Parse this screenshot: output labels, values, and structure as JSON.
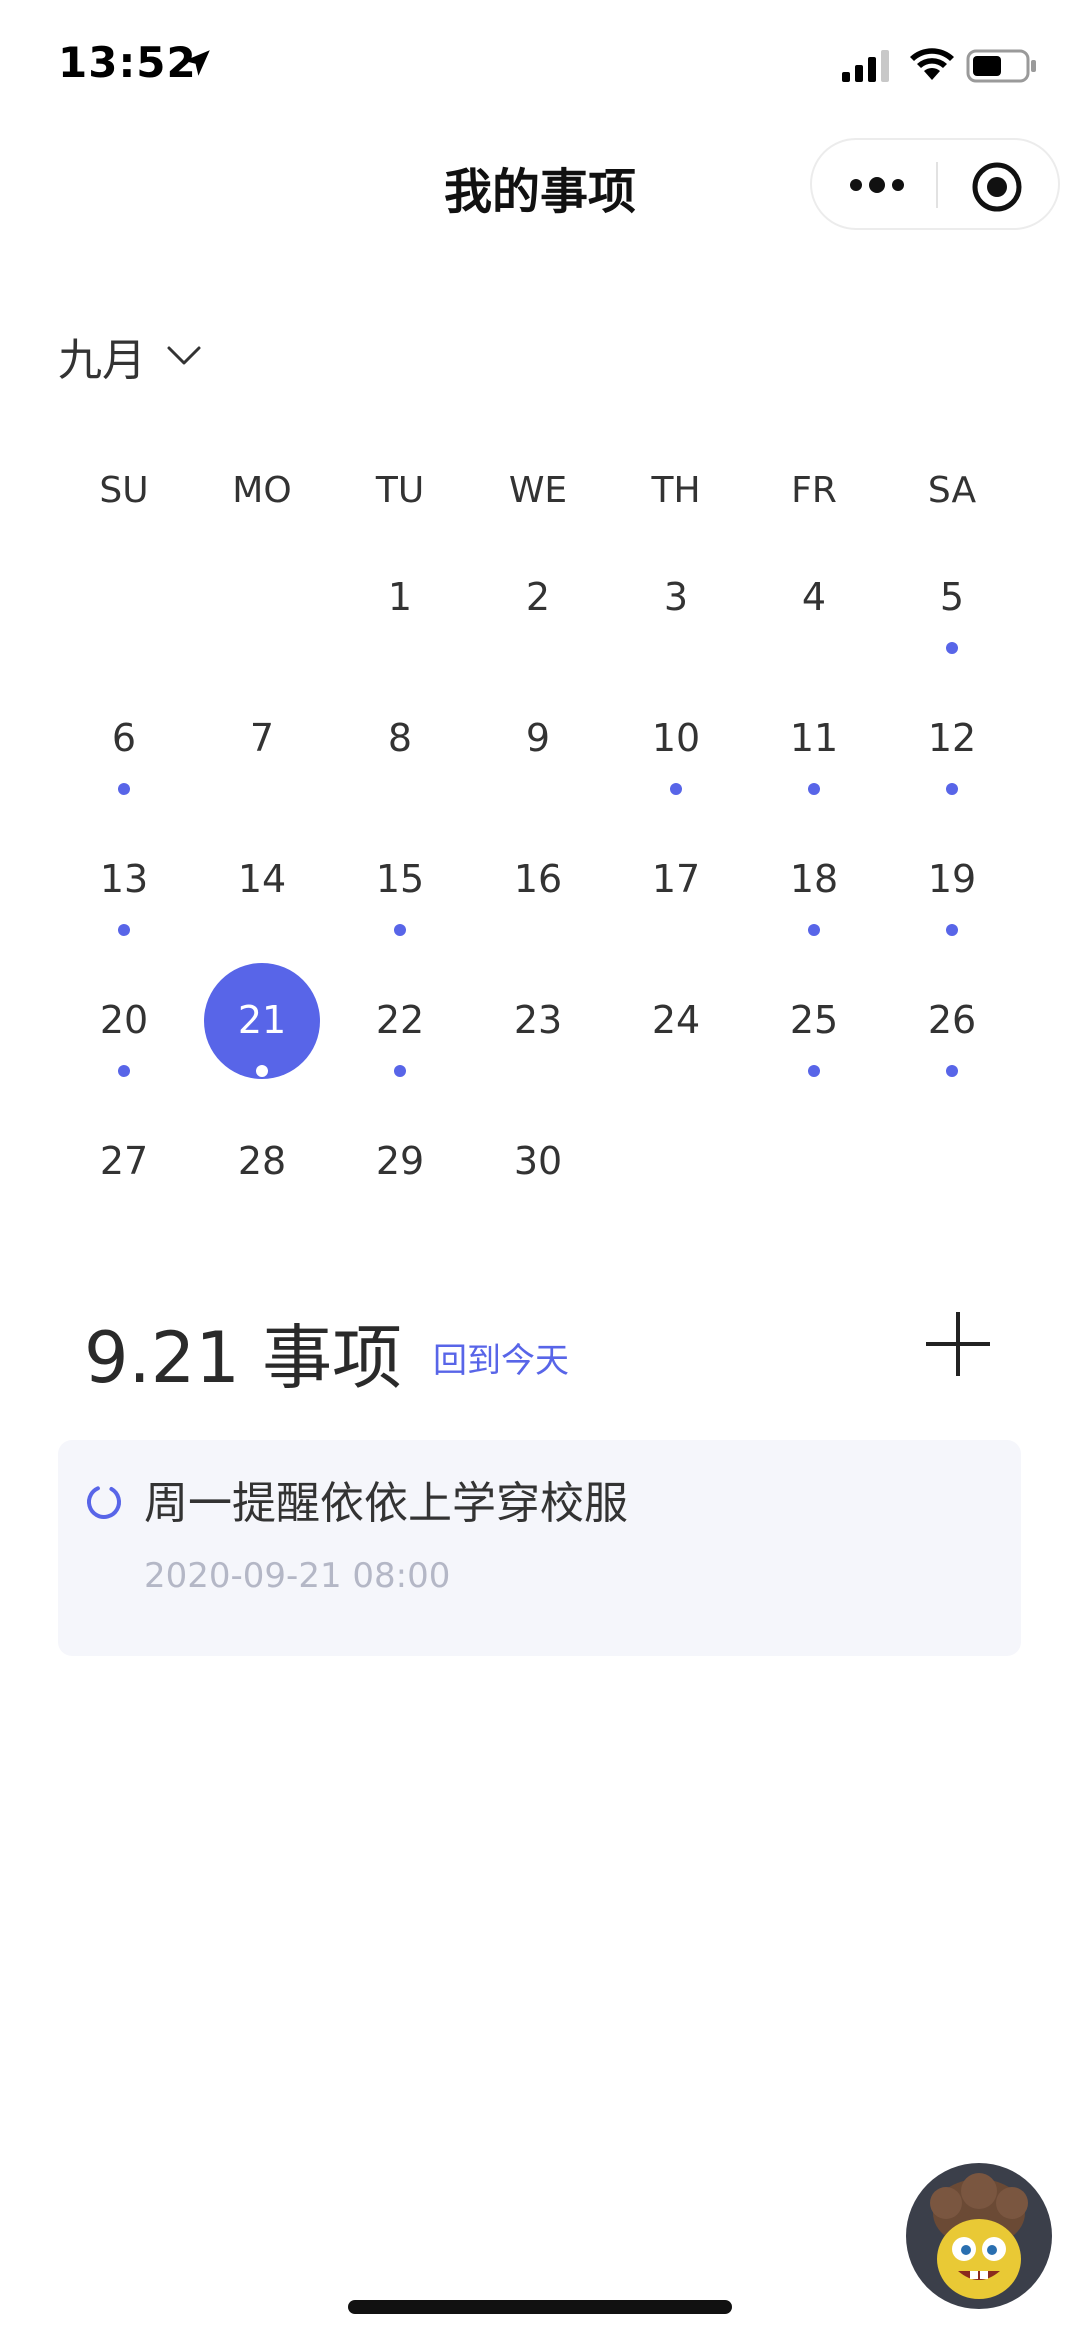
{
  "status_bar": {
    "time": "13:52"
  },
  "nav": {
    "title": "我的事项"
  },
  "calendar": {
    "month_label": "九月",
    "weekdays": [
      "SU",
      "MO",
      "TU",
      "WE",
      "TH",
      "FR",
      "SA"
    ],
    "leading_blank_days": 2,
    "days": [
      {
        "num": "1",
        "dot": false
      },
      {
        "num": "2",
        "dot": false
      },
      {
        "num": "3",
        "dot": false
      },
      {
        "num": "4",
        "dot": false
      },
      {
        "num": "5",
        "dot": true
      },
      {
        "num": "6",
        "dot": true
      },
      {
        "num": "7",
        "dot": false
      },
      {
        "num": "8",
        "dot": false
      },
      {
        "num": "9",
        "dot": false
      },
      {
        "num": "10",
        "dot": true
      },
      {
        "num": "11",
        "dot": true
      },
      {
        "num": "12",
        "dot": true
      },
      {
        "num": "13",
        "dot": true
      },
      {
        "num": "14",
        "dot": false
      },
      {
        "num": "15",
        "dot": true
      },
      {
        "num": "16",
        "dot": false
      },
      {
        "num": "17",
        "dot": false
      },
      {
        "num": "18",
        "dot": true
      },
      {
        "num": "19",
        "dot": true
      },
      {
        "num": "20",
        "dot": true
      },
      {
        "num": "21",
        "dot": true,
        "selected": true
      },
      {
        "num": "22",
        "dot": true
      },
      {
        "num": "23",
        "dot": false
      },
      {
        "num": "24",
        "dot": false
      },
      {
        "num": "25",
        "dot": true
      },
      {
        "num": "26",
        "dot": true
      },
      {
        "num": "27",
        "dot": false
      },
      {
        "num": "28",
        "dot": false
      },
      {
        "num": "29",
        "dot": false
      },
      {
        "num": "30",
        "dot": false
      }
    ]
  },
  "events": {
    "title": "9.21 事项",
    "back_today": "回到今天",
    "add_icon": "plus-icon",
    "items": [
      {
        "title": "周一提醒依依上学穿校服",
        "time": "2020-09-21 08:00",
        "status_icon": "pending-circle-icon"
      }
    ]
  },
  "colors": {
    "accent": "#5865e8",
    "card_bg": "#f5f6fb",
    "muted_text": "#b4b7c6"
  }
}
